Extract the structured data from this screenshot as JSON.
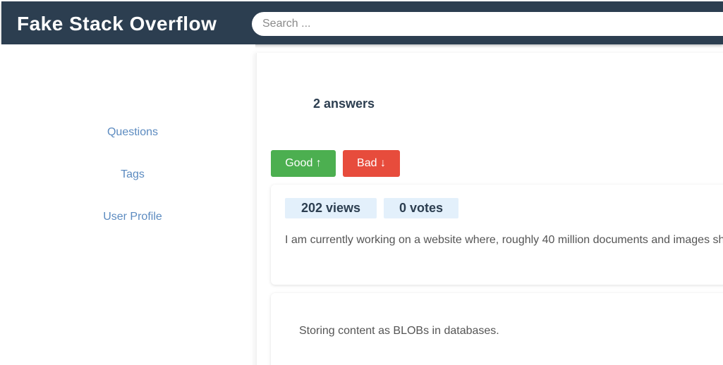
{
  "header": {
    "logo": "Fake Stack Overflow",
    "search_placeholder": "Search ..."
  },
  "sidebar": {
    "items": [
      {
        "label": "Questions"
      },
      {
        "label": "Tags"
      },
      {
        "label": "User Profile"
      }
    ]
  },
  "main": {
    "answers_count": "2 answers",
    "good_button": "Good ↑",
    "bad_button": "Bad ↓",
    "question": {
      "views": "202 views",
      "votes": "0 votes",
      "text": "I am currently working on a website where, roughly 40 million documents and images sh"
    },
    "answer": {
      "text": "Storing content as BLOBs in databases."
    }
  },
  "colors": {
    "header_bg": "#2c3e50",
    "link": "#5c8bc0",
    "good": "#4caf50",
    "bad": "#e74c3c",
    "stat_bg": "#e3f0fb"
  }
}
